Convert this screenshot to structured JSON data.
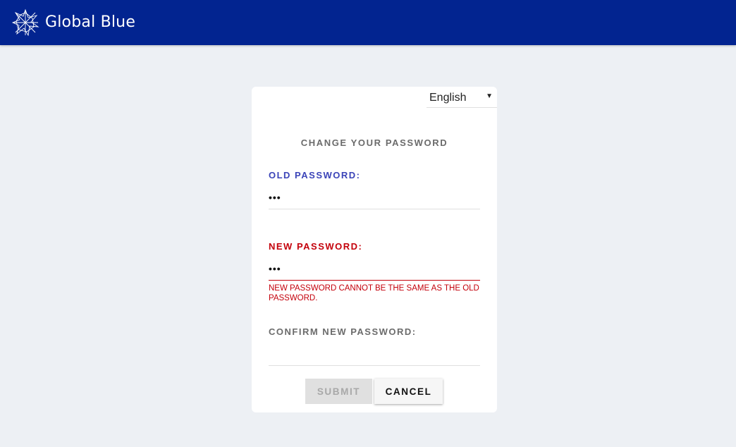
{
  "header": {
    "brand": "Global Blue",
    "background_color": "#022490",
    "logo_icon": "star-burst-logo-icon"
  },
  "card": {
    "language": {
      "selected": "English",
      "caret_icon": "caret-down-icon"
    },
    "title": "CHANGE YOUR PASSWORD",
    "fields": {
      "old_password": {
        "label": "OLD PASSWORD:",
        "value": "•••",
        "label_color": "#3b44b8"
      },
      "new_password": {
        "label": "NEW PASSWORD:",
        "value": "•••",
        "error": "NEW PASSWORD CANNOT BE THE SAME AS THE OLD PASSWORD.",
        "error_color": "#c4000b"
      },
      "confirm_password": {
        "label": "CONFIRM NEW PASSWORD:",
        "value": ""
      }
    },
    "buttons": {
      "submit": "SUBMIT",
      "cancel": "CANCEL"
    }
  }
}
